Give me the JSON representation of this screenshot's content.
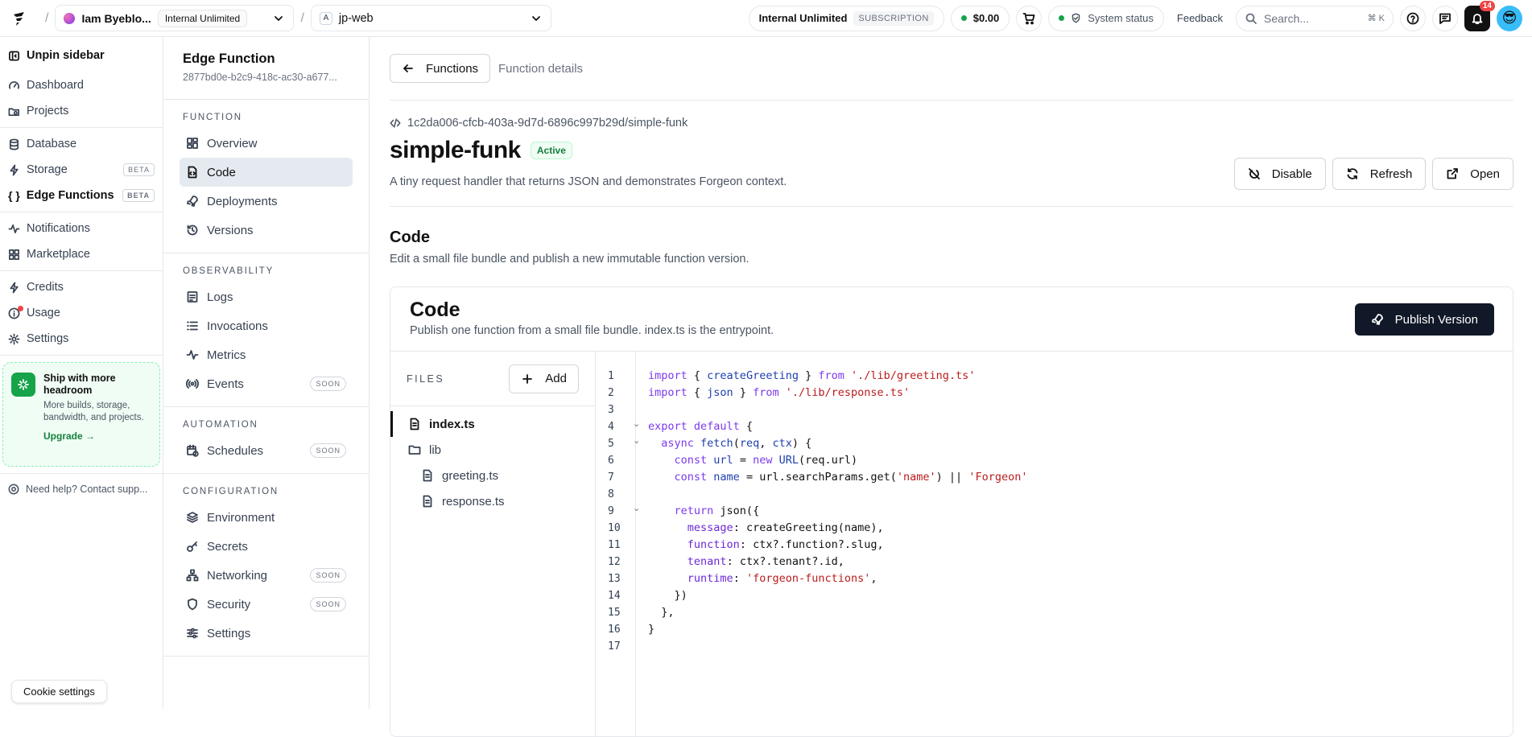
{
  "topbar": {
    "org_name": "Iam Byeblo...",
    "org_plan": "Internal Unlimited",
    "project_badge": "A",
    "project_name": "jp-web",
    "subscription_plan": "Internal Unlimited",
    "subscription_tag": "SUBSCRIPTION",
    "balance": "$0.00",
    "system_status": "System status",
    "feedback": "Feedback",
    "search_placeholder": "Search...",
    "search_shortcut": "⌘ K",
    "notifications_count": "14",
    "avatar": "😎"
  },
  "sidebar": {
    "unpin": "Unpin sidebar",
    "items": [
      {
        "label": "Dashboard"
      },
      {
        "label": "Projects"
      },
      {
        "label": "Database"
      },
      {
        "label": "Storage",
        "badge": "BETA"
      },
      {
        "label": "Edge Functions",
        "badge": "BETA"
      },
      {
        "label": "Notifications"
      },
      {
        "label": "Marketplace"
      },
      {
        "label": "Credits"
      },
      {
        "label": "Usage"
      },
      {
        "label": "Settings"
      }
    ],
    "promo": {
      "title": "Ship with more headroom",
      "text": "More builds, storage, bandwidth, and projects.",
      "link": "Upgrade →"
    },
    "help": "Need help? Contact supp...",
    "cookie": "Cookie settings"
  },
  "subnav": {
    "title": "Edge Function",
    "id": "2877bd0e-b2c9-418c-ac30-a677...",
    "sections": [
      {
        "label": "FUNCTION",
        "items": [
          {
            "label": "Overview"
          },
          {
            "label": "Code"
          },
          {
            "label": "Deployments"
          },
          {
            "label": "Versions"
          }
        ]
      },
      {
        "label": "OBSERVABILITY",
        "items": [
          {
            "label": "Logs"
          },
          {
            "label": "Invocations"
          },
          {
            "label": "Metrics"
          },
          {
            "label": "Events",
            "badge": "SOON"
          }
        ]
      },
      {
        "label": "AUTOMATION",
        "items": [
          {
            "label": "Schedules",
            "badge": "SOON"
          }
        ]
      },
      {
        "label": "CONFIGURATION",
        "items": [
          {
            "label": "Environment"
          },
          {
            "label": "Secrets"
          },
          {
            "label": "Networking",
            "badge": "SOON"
          },
          {
            "label": "Security",
            "badge": "SOON"
          },
          {
            "label": "Settings"
          }
        ]
      }
    ]
  },
  "main": {
    "back_label": "Functions",
    "breadcrumb": "Function details",
    "path": "1c2da006-cfcb-403a-9d7d-6896c997b29d/simple-funk",
    "function_name": "simple-funk",
    "status": "Active",
    "description": "A tiny request handler that returns JSON and demonstrates Forgeon context.",
    "actions": {
      "disable": "Disable",
      "refresh": "Refresh",
      "open": "Open"
    },
    "section_title": "Code",
    "section_desc": "Edit a small file bundle and publish a new immutable function version.",
    "card": {
      "title": "Code",
      "desc": "Publish one function from a small file bundle. index.ts is the entrypoint.",
      "publish": "Publish Version",
      "files_label": "FILES",
      "add": "Add",
      "files": [
        {
          "name": "index.ts",
          "type": "file"
        },
        {
          "name": "lib",
          "type": "folder"
        },
        {
          "name": "greeting.ts",
          "type": "file"
        },
        {
          "name": "response.ts",
          "type": "file"
        }
      ]
    }
  },
  "colors": {
    "accent": "#111827",
    "active_green": "#16a34a"
  }
}
